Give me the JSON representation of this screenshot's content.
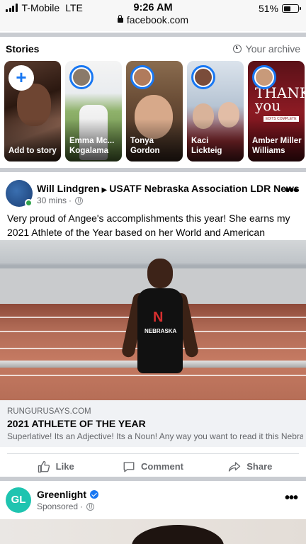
{
  "status_bar": {
    "carrier": "T-Mobile",
    "network": "LTE",
    "time": "9:26 AM",
    "url": "facebook.com",
    "battery_percent": "51%",
    "battery_level": 0.51
  },
  "stories": {
    "title": "Stories",
    "archive_label": "Your archive",
    "items": [
      {
        "name": "Add to story"
      },
      {
        "name": "Emma Mc... Kogalama"
      },
      {
        "name": "Tonya Gordon"
      },
      {
        "name": "Kaci Lickteig"
      },
      {
        "name": "Amber Miller Williams"
      }
    ],
    "amber_card_text": {
      "headline": "THANK you",
      "badge": "EDITS COMPLETE"
    }
  },
  "post": {
    "author": "Will Lindgren",
    "arrow": "▶",
    "group": "USATF Nebraska Association LDR News",
    "time": "30 mins",
    "more": "•••",
    "text": "Very proud of Angee's accomplishments this year! She earns my 2021 Athlete of the Year based on her World and American Records!",
    "photo_text": {
      "jersey": "NEBRASKA"
    },
    "link": {
      "domain": "RUNGURUSAYS.COM",
      "title": "2021 ATHLETE OF THE YEAR",
      "description": "Superlative! Its an Adjective! Its a Noun! Any way you want to read it this Nebras..."
    },
    "actions": {
      "like": "Like",
      "comment": "Comment",
      "share": "Share"
    }
  },
  "sponsored_post": {
    "logo_text": "GL",
    "name": "Greenlight",
    "label": "Sponsored",
    "more": "•••"
  }
}
